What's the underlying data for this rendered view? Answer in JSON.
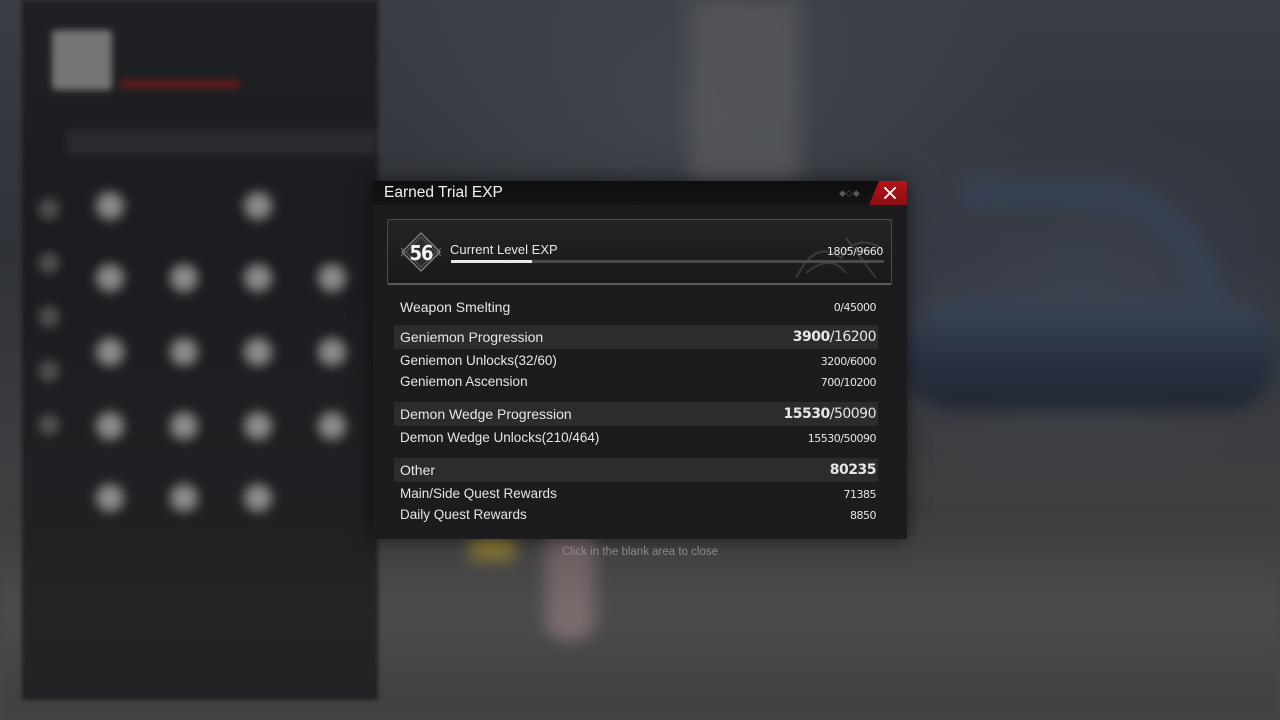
{
  "modal": {
    "title": "Earned Trial EXP",
    "current_level": {
      "level": "56",
      "label": "Current Level EXP",
      "value": "1805/9660",
      "progress": 0.187
    },
    "weapon_smelting": {
      "label": "Weapon Smelting",
      "value": "0/45000"
    },
    "geniemon": {
      "label": "Geniemon Progression",
      "value_current": "3900",
      "value_total": "/16200",
      "items": [
        {
          "label": "Geniemon Unlocks(32/60)",
          "value": "3200/6000"
        },
        {
          "label": "Geniemon Ascension",
          "value": "700/10200"
        }
      ]
    },
    "demon_wedge": {
      "label": "Demon Wedge Progression",
      "value_current": "15530",
      "value_total": "/50090",
      "items": [
        {
          "label": "Demon Wedge Unlocks(210/464)",
          "value": "15530/50090"
        }
      ]
    },
    "other": {
      "label": "Other",
      "value": "80235",
      "items": [
        {
          "label": "Main/Side Quest Rewards",
          "value": "71385"
        },
        {
          "label": "Daily Quest Rewards",
          "value": "8850"
        }
      ]
    }
  },
  "hint": "Click in the blank area to close",
  "icons": {
    "close": "close-icon",
    "level_emblem": "level-emblem-icon"
  },
  "colors": {
    "close_button": "#b3151a",
    "modal_bg": "#1c1c1e",
    "progress_fill": "#e9e9e9"
  }
}
